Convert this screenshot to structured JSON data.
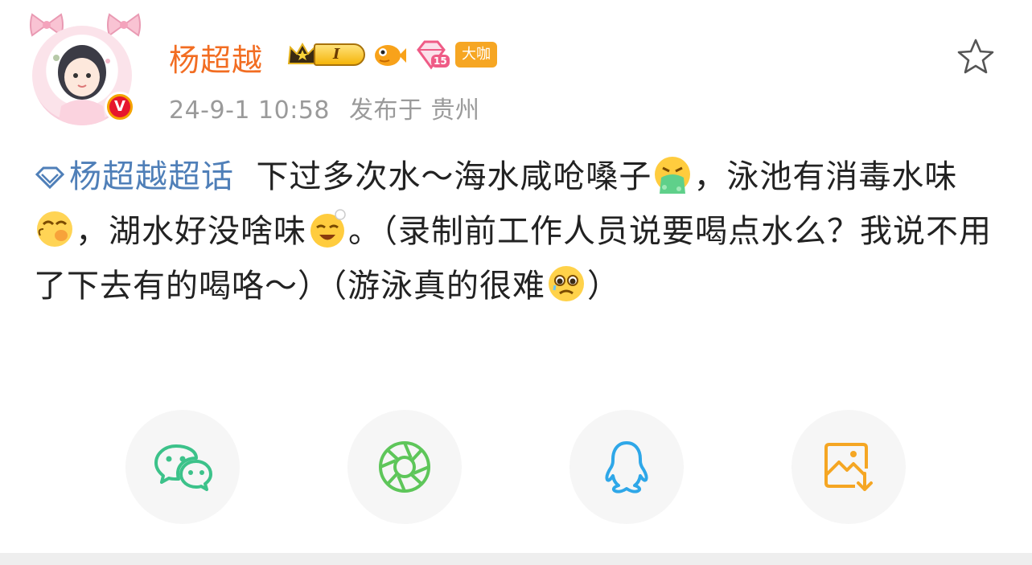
{
  "header": {
    "username": "杨超越",
    "level_text": "I",
    "badge_dakao": "大咖",
    "badge_fan_level": "15",
    "timestamp": "24-9-1 10:58",
    "location": "发布于 贵州"
  },
  "post": {
    "topic": "杨超越超话",
    "segments": [
      "下过多次水～海水咸呛嗓子",
      "，泳池有消毒水味",
      "，湖水好没啥味",
      "。（录制前工作人员说要喝点水么？我说不用了下去有的喝咯～）（游泳真的很难",
      "）"
    ],
    "emoji_names": [
      "vomit-emoji",
      "hot-face-emoji",
      "relieved-emoji",
      "pleading-emoji"
    ]
  },
  "share": {
    "buttons": [
      "wechat-icon",
      "moments-icon",
      "qq-icon",
      "save-image-icon"
    ]
  },
  "colors": {
    "username": "#f26d22",
    "topic": "#4f7fb8",
    "meta": "#9a9a9a",
    "wechat": "#3cc28a",
    "moments": "#5ec65a",
    "qq": "#2ea7e8",
    "save": "#f5a623"
  }
}
